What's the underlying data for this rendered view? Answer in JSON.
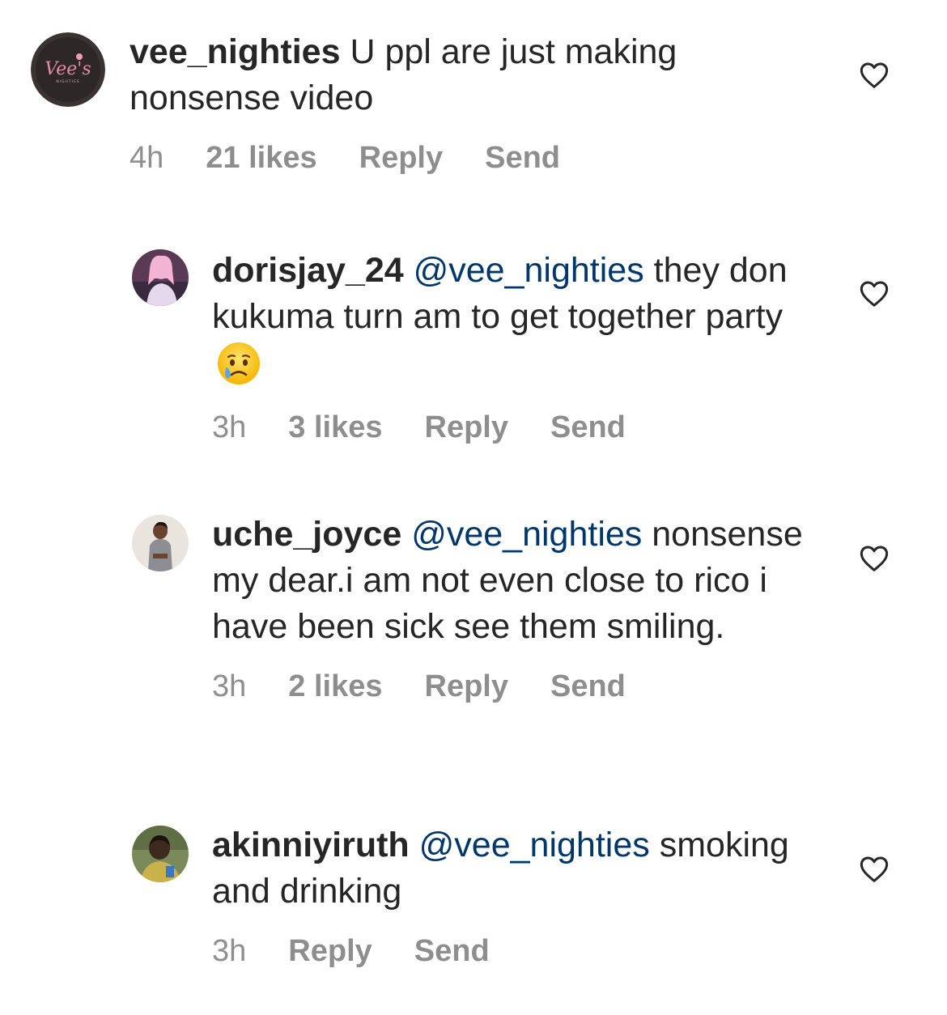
{
  "comments": [
    {
      "username": "vee_nighties",
      "mention": "",
      "text": " U ppl are just making nonsense video",
      "emoji": "",
      "time": "4h",
      "likes": "21 likes",
      "reply": "Reply",
      "send": "Send",
      "avatar_logo_text": "Vee's",
      "avatar_logo_sub": "NIGHTIES",
      "avatar_icon": "vee-nighties-logo-avatar"
    },
    {
      "username": "dorisjay_24",
      "mention": "@vee_nighties",
      "text": " they don kukuma turn am to get together party",
      "emoji": "crying-face-emoji",
      "time": "3h",
      "likes": "3 likes",
      "reply": "Reply",
      "send": "Send",
      "avatar_icon": "user-photo-avatar"
    },
    {
      "username": "uche_joyce",
      "mention": "@vee_nighties",
      "text": " nonsense my dear.i am not even close to rico i have been sick see them smiling.",
      "emoji": "",
      "time": "3h",
      "likes": "2 likes",
      "reply": "Reply",
      "send": "Send",
      "avatar_icon": "user-photo-avatar"
    },
    {
      "username": "akinniyiruth",
      "mention": "@vee_nighties",
      "text": " smoking and drinking",
      "emoji": "",
      "time": "3h",
      "likes": "",
      "reply": "Reply",
      "send": "Send",
      "avatar_icon": "user-photo-avatar"
    }
  ],
  "colors": {
    "text": "#262626",
    "meta": "#8e8e8e",
    "mention": "#00376b",
    "heart": "#262626"
  },
  "heart_icon": "heart-outline-icon"
}
